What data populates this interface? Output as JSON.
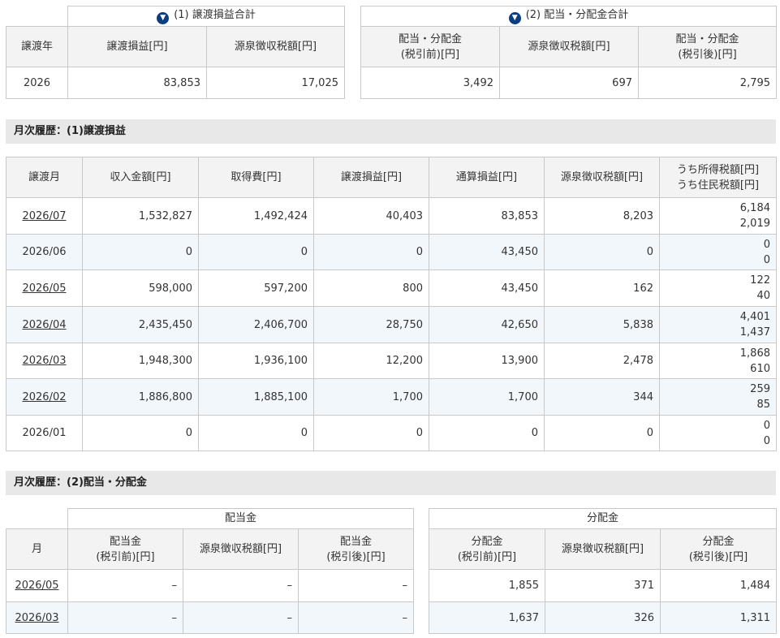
{
  "summary_transfer": {
    "caption": "(1) 譲渡損益合計",
    "col_year": "譲渡年",
    "col_gain": "譲渡損益[円]",
    "col_tax": "源泉徴収税額[円]",
    "row": {
      "year": "2026",
      "gain": "83,853",
      "tax": "17,025"
    }
  },
  "summary_dividend": {
    "caption": "(2) 配当・分配金合計",
    "col_before_1": "配当・分配金",
    "col_before_2": "(税引前)[円]",
    "col_tax": "源泉徴収税額[円]",
    "col_after_1": "配当・分配金",
    "col_after_2": "(税引後)[円]",
    "row": {
      "before": "3,492",
      "tax": "697",
      "after": "2,795"
    }
  },
  "section_transfer_title": "月次履歴：(1)譲渡損益",
  "monthly_transfer": {
    "headers": {
      "month": "譲渡月",
      "income": "収入金額[円]",
      "cost": "取得費[円]",
      "gain": "譲渡損益[円]",
      "cumulative": "通算損益[円]",
      "tax": "源泉徴収税額[円]",
      "tax_income": "うち所得税額[円]",
      "tax_resident": "うち住民税額[円]"
    },
    "rows": [
      {
        "month": "2026/07",
        "income": "1,532,827",
        "cost": "1,492,424",
        "gain": "40,403",
        "cumulative": "83,853",
        "tax": "8,203",
        "tax_income": "6,184",
        "tax_resident": "2,019"
      },
      {
        "month": "2026/06",
        "income": "0",
        "cost": "0",
        "gain": "0",
        "cumulative": "43,450",
        "tax": "0",
        "tax_income": "0",
        "tax_resident": "0"
      },
      {
        "month": "2026/05",
        "income": "598,000",
        "cost": "597,200",
        "gain": "800",
        "cumulative": "43,450",
        "tax": "162",
        "tax_income": "122",
        "tax_resident": "40"
      },
      {
        "month": "2026/04",
        "income": "2,435,450",
        "cost": "2,406,700",
        "gain": "28,750",
        "cumulative": "42,650",
        "tax": "5,838",
        "tax_income": "4,401",
        "tax_resident": "1,437"
      },
      {
        "month": "2026/03",
        "income": "1,948,300",
        "cost": "1,936,100",
        "gain": "12,200",
        "cumulative": "13,900",
        "tax": "2,478",
        "tax_income": "1,868",
        "tax_resident": "610"
      },
      {
        "month": "2026/02",
        "income": "1,886,800",
        "cost": "1,885,100",
        "gain": "1,700",
        "cumulative": "1,700",
        "tax": "344",
        "tax_income": "259",
        "tax_resident": "85"
      },
      {
        "month": "2026/01",
        "income": "0",
        "cost": "0",
        "gain": "0",
        "cumulative": "0",
        "tax": "0",
        "tax_income": "0",
        "tax_resident": "0"
      }
    ]
  },
  "section_dividend_title": "月次履歴：(2)配当・分配金",
  "monthly_dividend": {
    "group_dividend": "配当金",
    "group_distribution": "分配金",
    "headers": {
      "month": "月",
      "div_before_1": "配当金",
      "div_before_2": "(税引前)[円]",
      "div_tax": "源泉徴収税額[円]",
      "div_after_1": "配当金",
      "div_after_2": "(税引後)[円]",
      "dist_before_1": "分配金",
      "dist_before_2": "(税引前)[円]",
      "dist_tax": "源泉徴収税額[円]",
      "dist_after_1": "分配金",
      "dist_after_2": "(税引後)[円]"
    },
    "rows": [
      {
        "month": "2026/05",
        "div_before": "–",
        "div_tax": "–",
        "div_after": "–",
        "dist_before": "1,855",
        "dist_tax": "371",
        "dist_after": "1,484"
      },
      {
        "month": "2026/03",
        "div_before": "–",
        "div_tax": "–",
        "div_after": "–",
        "dist_before": "1,637",
        "dist_tax": "326",
        "dist_after": "1,311"
      }
    ]
  }
}
